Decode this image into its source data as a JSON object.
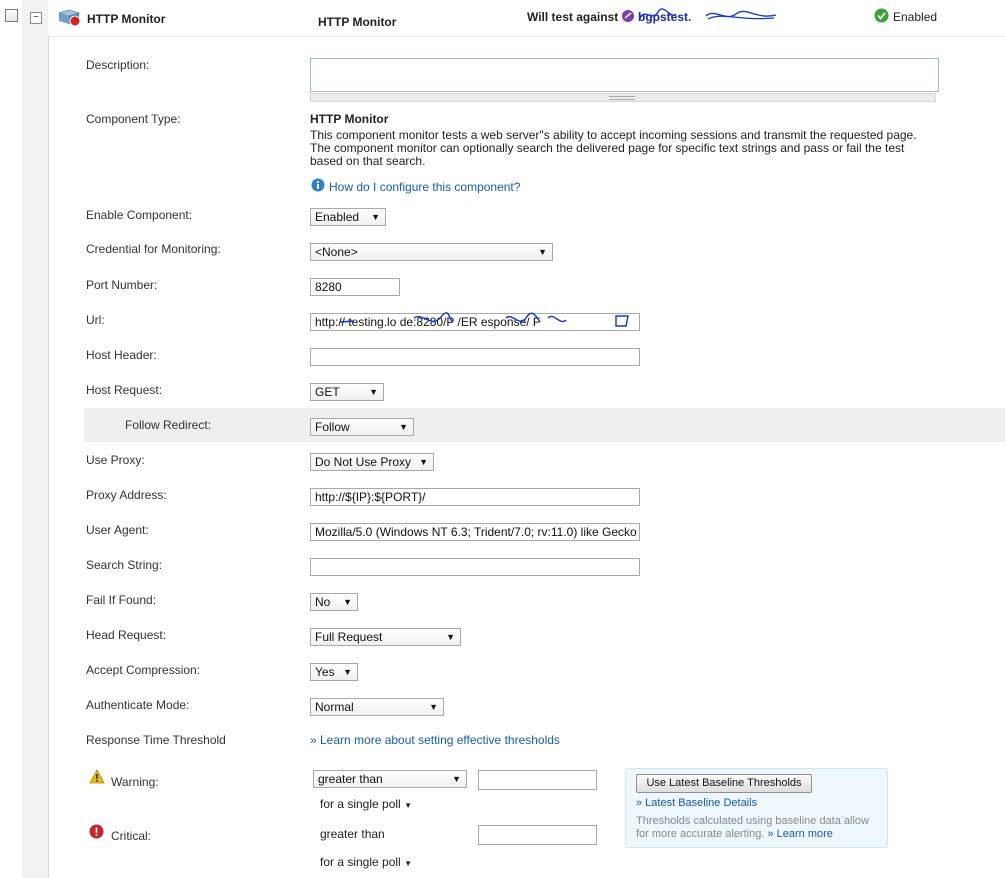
{
  "header": {
    "component_name": "HTTP Monitor",
    "component_type_title": "HTTP Monitor",
    "test_against_label": "Will test against",
    "test_against_target": "bgpstest.",
    "status_text": "Enabled"
  },
  "fields": {
    "description": {
      "label": "Description:",
      "value": ""
    },
    "component_type": {
      "label": "Component Type:",
      "title": "HTTP Monitor",
      "desc_line1": "This component monitor tests a web server\"s ability to accept incoming sessions and transmit the requested page.",
      "desc_line2": "The component monitor can optionally search the delivered page for specific text strings and pass or fail the test",
      "desc_line3": "based on that search.",
      "help_link": "How do I configure this component?"
    },
    "enable_component": {
      "label": "Enable Component:",
      "value": "Enabled"
    },
    "credential": {
      "label": "Credential for Monitoring:",
      "value": "<None>"
    },
    "port": {
      "label": "Port Number:",
      "value": "8280"
    },
    "url": {
      "label": "Url:",
      "value": "http://  testing.lo     de:8280/P     /ER     esponse/  F"
    },
    "host_header": {
      "label": "Host Header:",
      "value": ""
    },
    "host_request": {
      "label": "Host Request:",
      "value": "GET"
    },
    "follow_redirect": {
      "label": "Follow Redirect:",
      "value": "Follow"
    },
    "use_proxy": {
      "label": "Use Proxy:",
      "value": "Do Not Use Proxy"
    },
    "proxy_address": {
      "label": "Proxy Address:",
      "value": "http://${IP}:${PORT}/"
    },
    "user_agent": {
      "label": "User Agent:",
      "value": "Mozilla/5.0 (Windows NT 6.3; Trident/7.0; rv:11.0) like Gecko"
    },
    "search_string": {
      "label": "Search String:",
      "value": ""
    },
    "fail_if_found": {
      "label": "Fail If Found:",
      "value": "No"
    },
    "head_request": {
      "label": "Head Request:",
      "value": "Full Request"
    },
    "accept_compression": {
      "label": "Accept Compression:",
      "value": "Yes"
    },
    "authenticate_mode": {
      "label": "Authenticate Mode:",
      "value": "Normal"
    },
    "response_time": {
      "label": "Response Time Threshold",
      "learn_link": "» Learn more about setting effective thresholds"
    }
  },
  "thresholds": {
    "warning": {
      "label": "Warning:",
      "operator": "greater than",
      "value": "",
      "poll": "for a single poll"
    },
    "critical": {
      "label": "Critical:",
      "operator": "greater than",
      "value": "",
      "poll": "for a single poll"
    }
  },
  "baseline_panel": {
    "button": "Use Latest Baseline Thresholds",
    "details_link": "» Latest Baseline Details",
    "note": "Thresholds calculated using baseline data allow for more accurate alerting.",
    "learn_more": "» Learn more"
  },
  "colors": {
    "link": "#1a5aa8",
    "enabled_green": "#3aa335",
    "critical_red": "#c0282d",
    "warning_yellow": "#e8b818"
  }
}
